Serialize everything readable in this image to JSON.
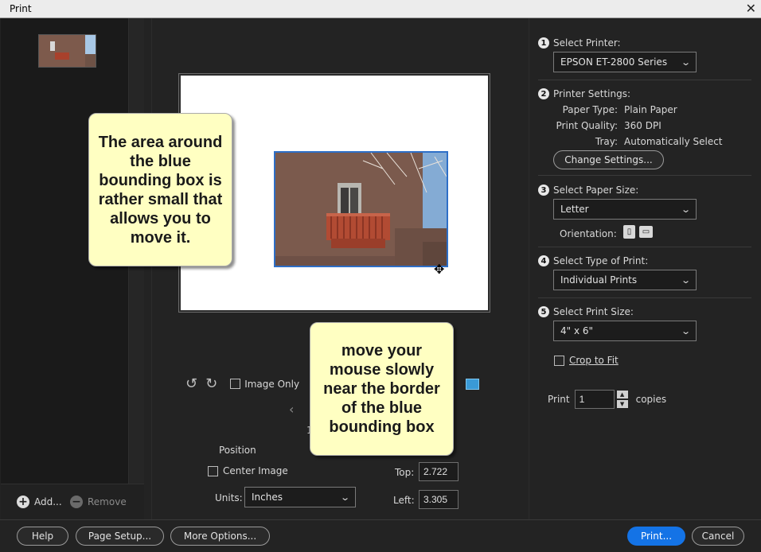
{
  "window": {
    "title": "Print"
  },
  "sidebar": {
    "add_label": "Add...",
    "remove_label": "Remove"
  },
  "preview": {
    "image_only_label": "Image Only",
    "page_indicator": "1",
    "position": {
      "heading": "Position",
      "center_image_label": "Center Image",
      "units_label": "Units:",
      "units_value": "Inches",
      "top_label": "Top:",
      "top_value": "2.722",
      "left_label": "Left:",
      "left_value": "3.305"
    }
  },
  "callouts": {
    "bounding_box_note": "The area around the blue bounding box is rather small that allows you to move it.",
    "hover_note": "move your mouse slowly near the border of the blue bounding box"
  },
  "settings": {
    "select_printer": {
      "num": "1",
      "label": "Select Printer:",
      "value": "EPSON ET-2800 Series"
    },
    "printer_settings": {
      "num": "2",
      "label": "Printer Settings:",
      "paper_type_key": "Paper Type:",
      "paper_type_value": "Plain Paper",
      "print_quality_key": "Print Quality:",
      "print_quality_value": "360 DPI",
      "tray_key": "Tray:",
      "tray_value": "Automatically Select",
      "change_button": "Change Settings..."
    },
    "paper_size": {
      "num": "3",
      "label": "Select Paper Size:",
      "value": "Letter",
      "orientation_label": "Orientation:"
    },
    "print_type": {
      "num": "4",
      "label": "Select Type of Print:",
      "value": "Individual Prints"
    },
    "print_size": {
      "num": "5",
      "label": "Select Print Size:",
      "value": "4\" x 6\"",
      "crop_label": "Crop to Fit"
    },
    "copies": {
      "print_label": "Print",
      "value": "1",
      "copies_label": "copies"
    }
  },
  "footer": {
    "help": "Help",
    "page_setup": "Page Setup...",
    "more_options": "More Options...",
    "print": "Print...",
    "cancel": "Cancel"
  },
  "colors": {
    "accent": "#1473e6",
    "bounding_box": "#2e6fc7",
    "callout_bg": "#ffffc2"
  }
}
